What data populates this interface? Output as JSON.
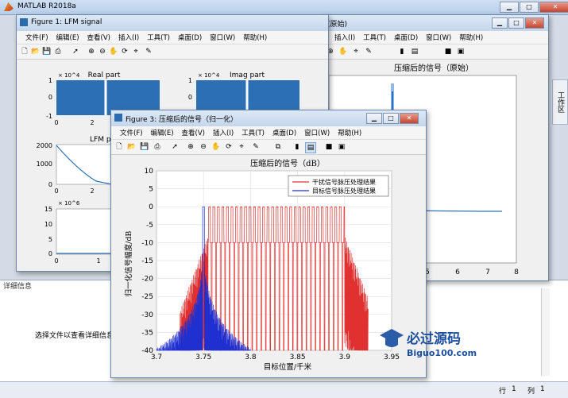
{
  "main": {
    "title": "MATLAB R2018a",
    "detail_header": "详细信息",
    "detail_text": "选择文件以查看详细信息",
    "side_tab": "工作区",
    "status": {
      "row_label": "行",
      "row_value": "1",
      "col_label": "列",
      "col_value": "1"
    }
  },
  "fig2": {
    "title_suffix": "(原始)",
    "menus": [
      "插入(I)",
      "工具(T)",
      "桌面(D)",
      "窗口(W)",
      "帮助(H)"
    ],
    "plot_title": "压缩后的信号（原始）",
    "xticks": [
      "5",
      "6",
      "7",
      "8"
    ]
  },
  "fig1": {
    "title": "Figure 1: LFM signal",
    "menus": [
      "文件(F)",
      "编辑(E)",
      "查看(V)",
      "插入(I)",
      "工具(T)",
      "桌面(D)",
      "窗口(W)",
      "帮助(H)"
    ],
    "real_title": "Real part",
    "imag_title": "Imag part",
    "phase_title": "LFM ph",
    "exp1": "× 10^4",
    "exp2": "× 10^4",
    "exp3": "× 10^6",
    "real_yticks": [
      "1",
      "0",
      "-1"
    ],
    "real_xticks": [
      "0",
      "2"
    ],
    "imag_yticks": [
      "1",
      "0",
      "-1"
    ],
    "phase_yticks": [
      "2000",
      "1000",
      "0"
    ],
    "phase_xticks": [
      "0",
      "2"
    ],
    "bottom_yticks": [
      "15",
      "10",
      "5",
      "0"
    ],
    "bottom_xticks": [
      "0",
      "1"
    ]
  },
  "fig3": {
    "title": "Figure 3: 压缩后的信号（归一化）",
    "menus": [
      "文件(F)",
      "编辑(E)",
      "查看(V)",
      "插入(I)",
      "工具(T)",
      "桌面(D)",
      "窗口(W)",
      "帮助(H)"
    ]
  },
  "chart_data": {
    "type": "line",
    "title": "压缩后的信号（dB）",
    "xlabel": "目标位置/千米",
    "ylabel": "归一化信号幅度/dB",
    "xlim": [
      3.7,
      3.95
    ],
    "ylim": [
      -40,
      10
    ],
    "xticks": [
      "3.7",
      "3.75",
      "3.8",
      "3.85",
      "3.9",
      "3.95"
    ],
    "yticks": [
      "10",
      "5",
      "0",
      "-5",
      "-10",
      "-15",
      "-20",
      "-25",
      "-30",
      "-35",
      "-40"
    ],
    "grid": true,
    "legend_position": "top-right",
    "series": [
      {
        "name": "干扰信号脉压处理结果",
        "color": "#e03030",
        "x_range": [
          3.725,
          3.925
        ],
        "passband": [
          3.755,
          3.9
        ],
        "peak": 0,
        "floor": -10
      },
      {
        "name": "目标信号脉压处理结果",
        "color": "#2030d0",
        "x_range": [
          3.7,
          3.8
        ],
        "peak_x": 3.75,
        "peak": 0
      }
    ]
  }
}
